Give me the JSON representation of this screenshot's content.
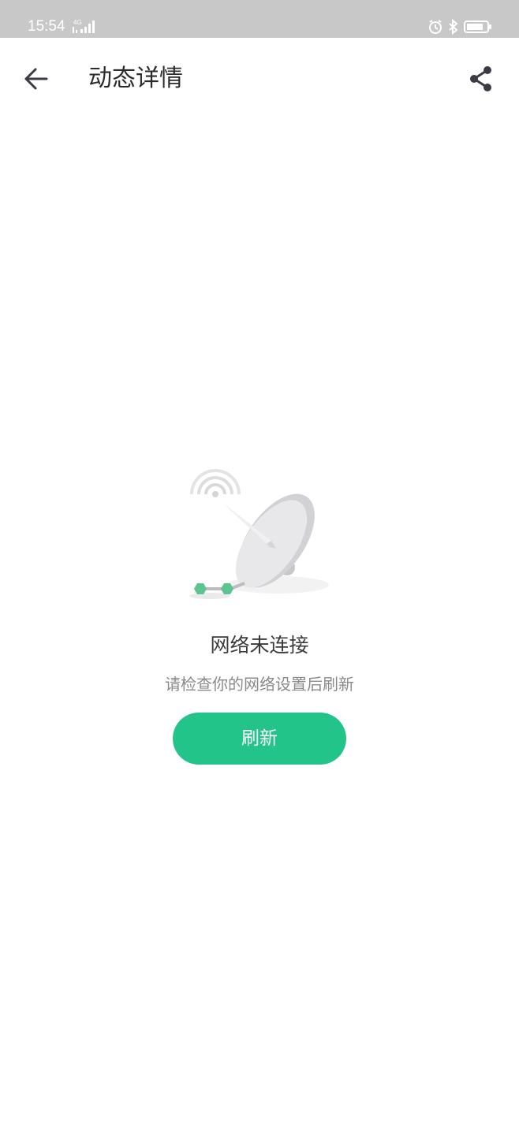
{
  "status_bar": {
    "time": "15:54",
    "network_label": "4G",
    "icons": [
      "alarm-icon",
      "bluetooth-icon",
      "battery-icon"
    ]
  },
  "header": {
    "title": "动态详情",
    "back_icon": "arrow-left-icon",
    "share_icon": "share-icon"
  },
  "empty_state": {
    "illustration": "satellite-dish-illustration",
    "title": "网络未连接",
    "subtitle": "请检查你的网络设置后刷新",
    "button_label": "刷新"
  },
  "colors": {
    "accent": "#23c48a",
    "status_bar": "#c8c8c8",
    "title_text": "#2b2b2b",
    "sub_text": "#8a8a8a"
  }
}
